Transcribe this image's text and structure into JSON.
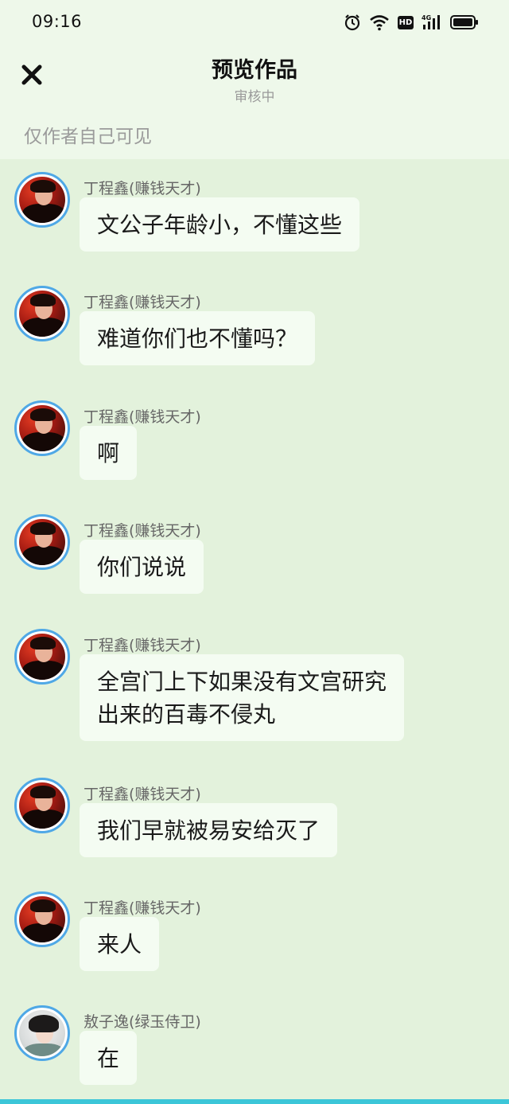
{
  "status_bar": {
    "time": "09:16",
    "hd_label": "HD",
    "network_label": "4G",
    "icons": [
      "alarm-icon",
      "wifi-icon",
      "hd-icon",
      "signal-4g-icon",
      "battery-icon"
    ]
  },
  "header": {
    "title": "预览作品",
    "subtitle": "审核中",
    "close_icon": "close-icon"
  },
  "notice": "仅作者自己可见",
  "colors": {
    "background": "#e3f2dc",
    "header_background": "#eef8ea",
    "bubble": "#f4fcf2",
    "avatar_ring": "#4fa8e6",
    "bottom_strip": "#3cc6d8"
  },
  "messages": [
    {
      "name": "丁程鑫(赚钱天才)",
      "avatar": "avatar-ding",
      "lines": [
        "文公子年龄小，不懂这些"
      ]
    },
    {
      "name": "丁程鑫(赚钱天才)",
      "avatar": "avatar-ding",
      "lines": [
        "难道你们也不懂吗？"
      ]
    },
    {
      "name": "丁程鑫(赚钱天才)",
      "avatar": "avatar-ding",
      "lines": [
        "啊"
      ]
    },
    {
      "name": "丁程鑫(赚钱天才)",
      "avatar": "avatar-ding",
      "lines": [
        "你们说说"
      ]
    },
    {
      "name": "丁程鑫(赚钱天才)",
      "avatar": "avatar-ding",
      "lines": [
        "全宫门上下如果没有文宫研究",
        "出来的百毒不侵丸"
      ]
    },
    {
      "name": "丁程鑫(赚钱天才)",
      "avatar": "avatar-ding",
      "lines": [
        "我们早就被易安给灭了"
      ]
    },
    {
      "name": "丁程鑫(赚钱天才)",
      "avatar": "avatar-ding",
      "lines": [
        "来人"
      ]
    },
    {
      "name": "敖子逸(绿玉侍卫)",
      "avatar": "avatar-ao",
      "lines": [
        "在"
      ]
    }
  ]
}
